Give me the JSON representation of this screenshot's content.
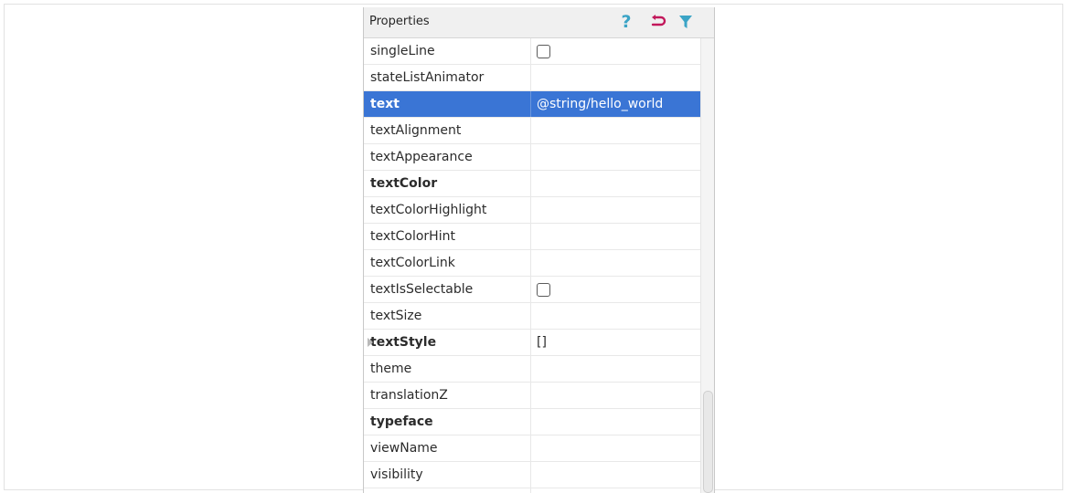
{
  "panel": {
    "title": "Properties",
    "icons": {
      "help": {
        "name": "help-icon",
        "glyph": "?"
      },
      "restore": {
        "name": "restore-icon"
      },
      "filter": {
        "name": "filter-icon"
      }
    }
  },
  "colors": {
    "accent": "#3a75d5",
    "help_icon": "#3ba4c6",
    "restore_icon": "#c2185b",
    "filter_icon": "#3ba4c6"
  },
  "properties": [
    {
      "name": "singleLine",
      "value": "",
      "bold": false,
      "checkbox": true
    },
    {
      "name": "stateListAnimator",
      "value": "",
      "bold": false
    },
    {
      "name": "text",
      "value": "@string/hello_world",
      "bold": true,
      "selected": true
    },
    {
      "name": "textAlignment",
      "value": "",
      "bold": false
    },
    {
      "name": "textAppearance",
      "value": "",
      "bold": false
    },
    {
      "name": "textColor",
      "value": "",
      "bold": true
    },
    {
      "name": "textColorHighlight",
      "value": "",
      "bold": false
    },
    {
      "name": "textColorHint",
      "value": "",
      "bold": false
    },
    {
      "name": "textColorLink",
      "value": "",
      "bold": false
    },
    {
      "name": "textIsSelectable",
      "value": "",
      "bold": false,
      "checkbox": true
    },
    {
      "name": "textSize",
      "value": "",
      "bold": false
    },
    {
      "name": "textStyle",
      "value": "[]",
      "bold": true,
      "expandable": true
    },
    {
      "name": "theme",
      "value": "",
      "bold": false
    },
    {
      "name": "translationZ",
      "value": "",
      "bold": false
    },
    {
      "name": "typeface",
      "value": "",
      "bold": true
    },
    {
      "name": "viewName",
      "value": "",
      "bold": false
    },
    {
      "name": "visibility",
      "value": "",
      "bold": false
    },
    {
      "name": "",
      "value": "",
      "bold": false
    }
  ]
}
